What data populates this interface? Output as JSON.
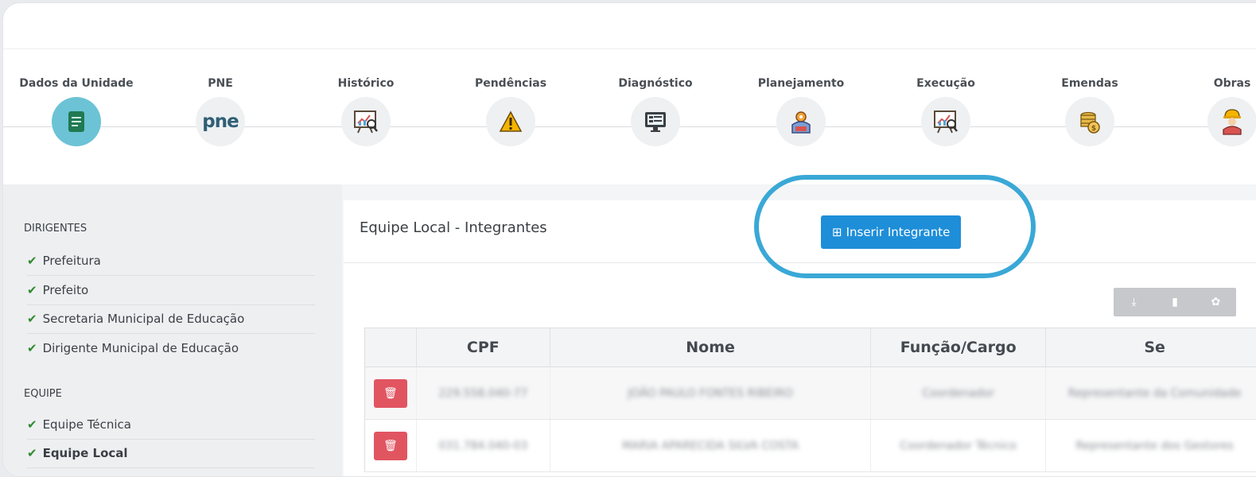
{
  "steps": [
    {
      "label": "Dados da Unidade",
      "icon": "document-icon",
      "active": true
    },
    {
      "label": "PNE",
      "icon": "pne-logo"
    },
    {
      "label": "Histórico",
      "icon": "chart-board-icon"
    },
    {
      "label": "Pendências",
      "icon": "warning-icon"
    },
    {
      "label": "Diagnóstico",
      "icon": "monitor-icon"
    },
    {
      "label": "Planejamento",
      "icon": "planning-icon"
    },
    {
      "label": "Execução",
      "icon": "chart-board-icon"
    },
    {
      "label": "Emendas",
      "icon": "coins-icon"
    },
    {
      "label": "Obras",
      "icon": "worker-icon"
    }
  ],
  "pne_logo_text": "pne",
  "sidebar": {
    "dirigentes_title": "DIRIGENTES",
    "dirigentes": [
      "Prefeitura",
      "Prefeito",
      "Secretaria Municipal de Educação",
      "Dirigente Municipal de Educação"
    ],
    "equipe_title": "EQUIPE",
    "equipe": [
      "Equipe Técnica",
      "Equipe Local"
    ]
  },
  "panel": {
    "title": "Equipe Local - Integrantes",
    "insert_button": "Inserir Integrante"
  },
  "table": {
    "headers": [
      "",
      "CPF",
      "Nome",
      "Função/Cargo",
      "Se"
    ],
    "rows": [
      {
        "cpf": "229.558.040-77",
        "nome": "JOÃO PAULO FONTES RIBEIRO",
        "funcao": "Coordenador",
        "segmento": "Representante da Comunidade"
      },
      {
        "cpf": "031.784.040-03",
        "nome": "MARIA APARECIDA SILVA COSTA",
        "funcao": "Coordenador Técnico",
        "segmento": "Representante dos Gestores"
      }
    ]
  },
  "colors": {
    "accent": "#1e8ed8",
    "highlight": "#3aa8d6",
    "danger": "#e15561",
    "active_step": "#6cc3d5"
  }
}
